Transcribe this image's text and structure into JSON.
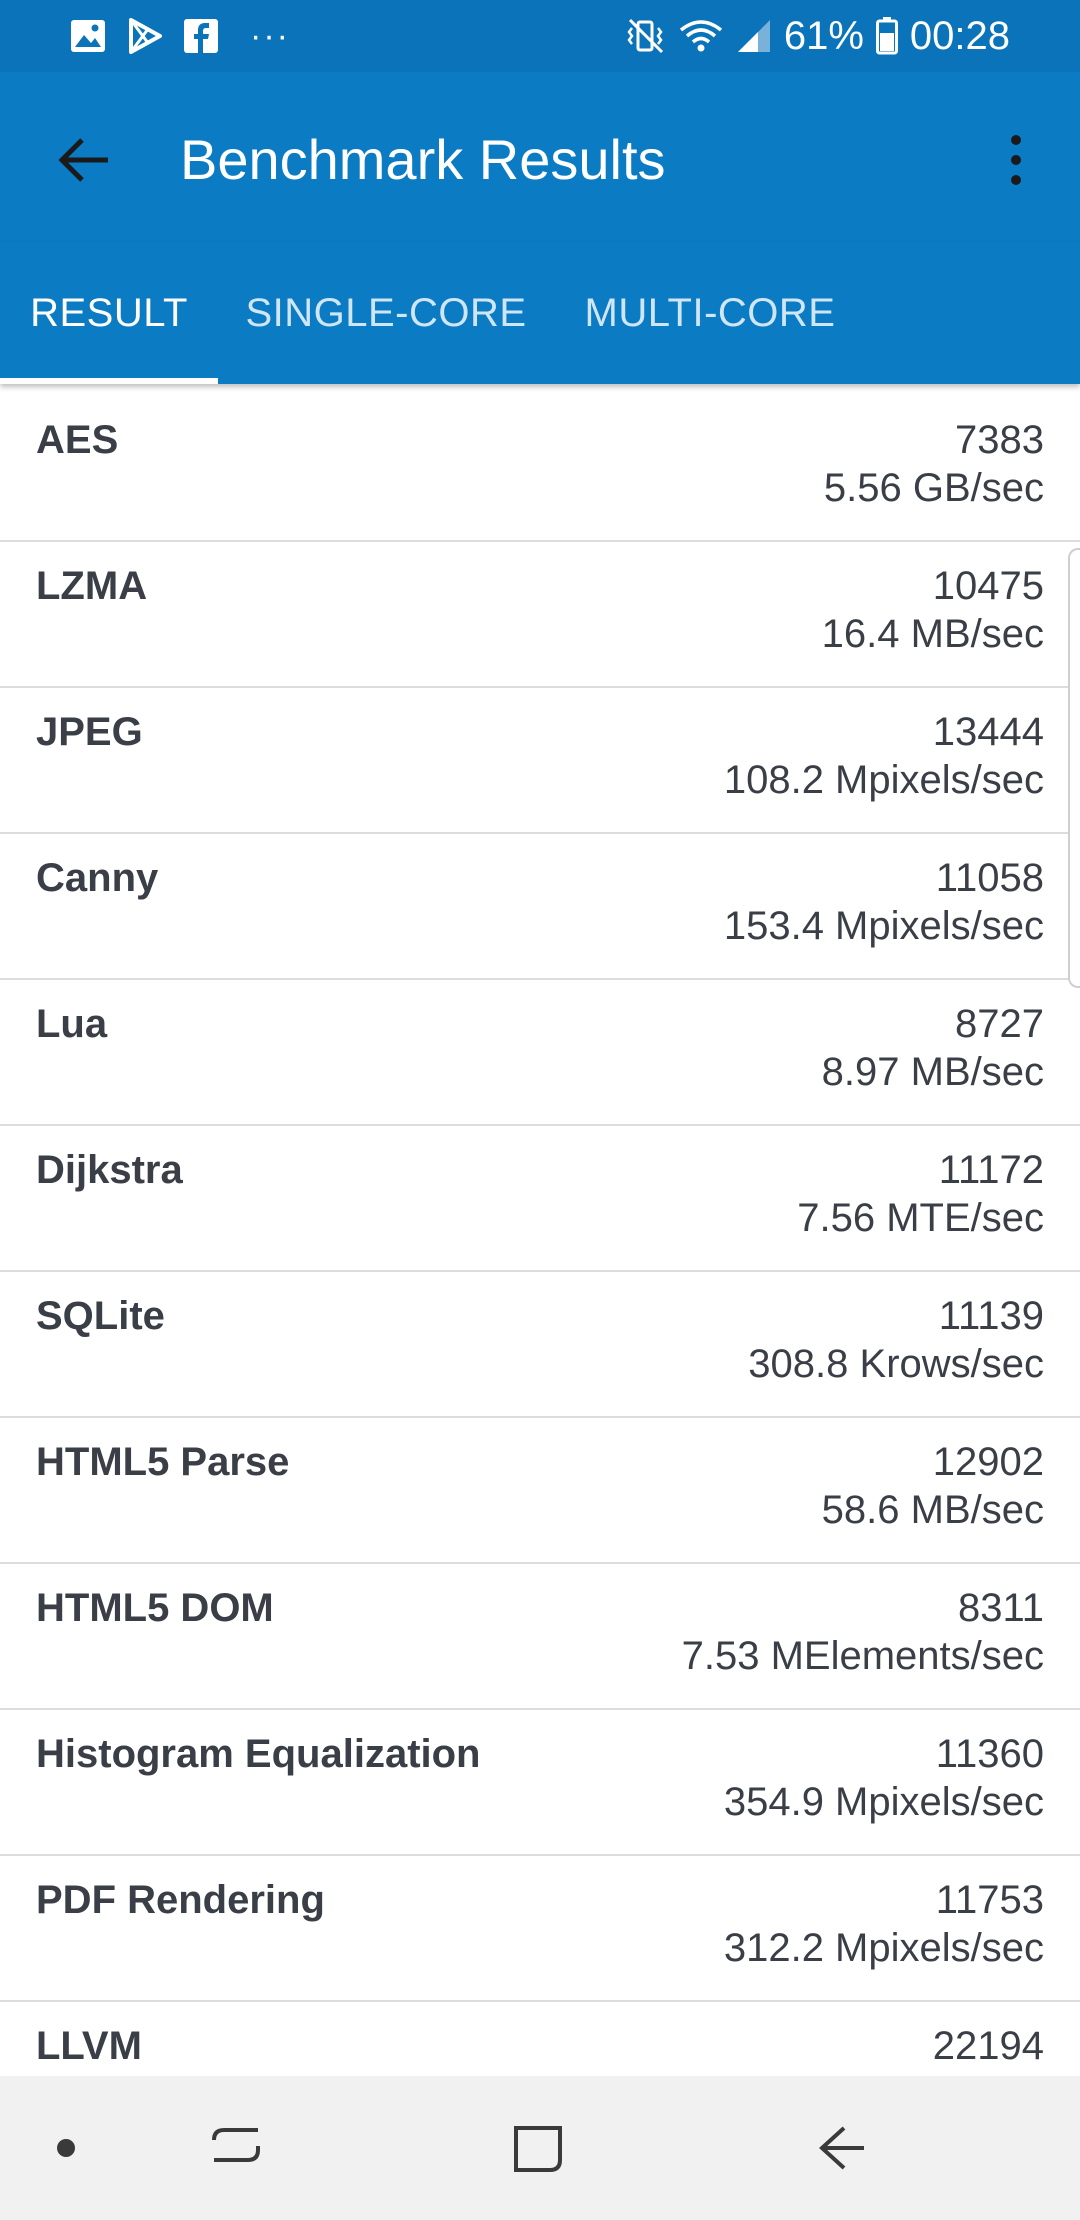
{
  "status_bar": {
    "notification_icons": [
      "image-icon",
      "play-store-icon",
      "facebook-icon",
      "more-dots-icon"
    ],
    "more_dots": "···",
    "battery": "61%",
    "time": "00:28",
    "system_icons": [
      "mute-vibrate-icon",
      "wifi-icon",
      "signal-icon",
      "battery-icon"
    ]
  },
  "app_bar": {
    "title": "Benchmark Results",
    "background_color": "#0b7bc3"
  },
  "tabs": [
    {
      "label": "RESULT",
      "active": true
    },
    {
      "label": "SINGLE-CORE",
      "active": false
    },
    {
      "label": "MULTI-CORE",
      "active": false
    }
  ],
  "results": [
    {
      "name": "AES",
      "score": "7383",
      "rate": "5.56 GB/sec"
    },
    {
      "name": "LZMA",
      "score": "10475",
      "rate": "16.4 MB/sec"
    },
    {
      "name": "JPEG",
      "score": "13444",
      "rate": "108.2 Mpixels/sec"
    },
    {
      "name": "Canny",
      "score": "11058",
      "rate": "153.4 Mpixels/sec"
    },
    {
      "name": "Lua",
      "score": "8727",
      "rate": "8.97 MB/sec"
    },
    {
      "name": "Dijkstra",
      "score": "11172",
      "rate": "7.56 MTE/sec"
    },
    {
      "name": "SQLite",
      "score": "11139",
      "rate": "308.8 Krows/sec"
    },
    {
      "name": "HTML5 Parse",
      "score": "12902",
      "rate": "58.6 MB/sec"
    },
    {
      "name": "HTML5 DOM",
      "score": "8311",
      "rate": "7.53 MElements/sec"
    },
    {
      "name": "Histogram Equalization",
      "score": "11360",
      "rate": "354.9 Mpixels/sec"
    },
    {
      "name": "PDF Rendering",
      "score": "11753",
      "rate": "312.2 Mpixels/sec"
    },
    {
      "name": "LLVM",
      "score": "22194",
      "rate": ""
    }
  ],
  "nav_bar": {
    "buttons": [
      "dot-icon",
      "recents-icon",
      "home-icon",
      "back-icon"
    ]
  }
}
